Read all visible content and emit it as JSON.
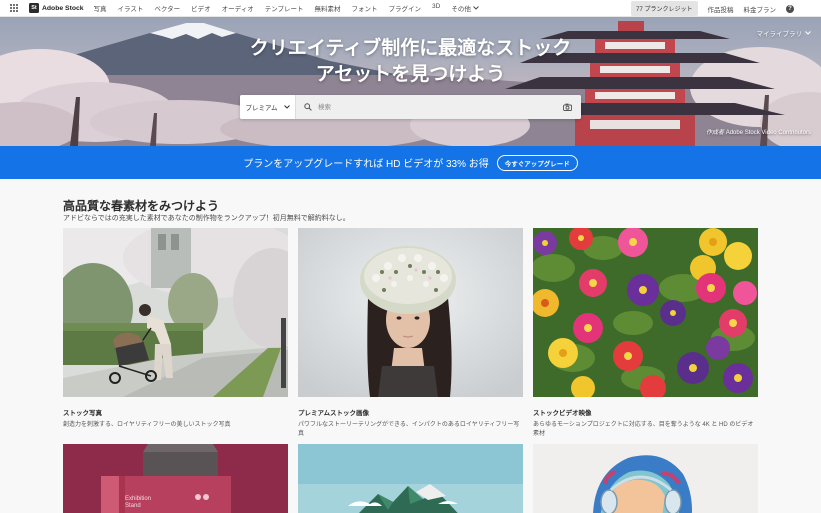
{
  "topnav": {
    "brand_logo": "St",
    "brand_name": "Adobe Stock",
    "links": [
      "写真",
      "イラスト",
      "ベクター",
      "ビデオ",
      "オーディオ",
      "テンプレート",
      "無料素材",
      "フォント",
      "プラグイン",
      "3D"
    ],
    "more_label": "その他",
    "credits_badge": "77 プランクレジット",
    "contributor_link": "作品投稿",
    "pricing_link": "料金プラン",
    "help_glyph": "?"
  },
  "hero": {
    "title_line1": "クリエイティブ制作に最適なストック",
    "title_line2": "アセットを見つけよう",
    "library_label": "マイライブラリ",
    "search": {
      "type_label": "プレミアム",
      "placeholder": "検索"
    },
    "credit_prefix": "作成者",
    "credit_name": "Adobe Stock Video Contributors"
  },
  "promo": {
    "text": "プランをアップグレードすれば HD ビデオが 33% お得",
    "button": "今すぐアップグレード"
  },
  "section": {
    "title": "高品質な春素材をみつけよう",
    "subtitle": "アドビならではの充実した素材であなたの制作物をランクアップ！初月無料で解約料なし。",
    "cards": [
      {
        "title": "ストック写真",
        "desc": "創造力を刺激する、ロイヤリティフリーの美しいストック写真"
      },
      {
        "title": "プレミアムストック画像",
        "desc": "パワフルなストーリーテリングができる、インパクトのあるロイヤリティフリー写真"
      },
      {
        "title": "ストックビデオ映像",
        "desc": "あらゆるモーションプロジェクトに対応する、目を奪うような 4K と HD のビデオ素材"
      }
    ],
    "template_box_text_1": "Exhibition",
    "template_box_text_2": "Stand"
  },
  "colors": {
    "promo_blue": "#1473e6",
    "content_bg": "#f8f8f8",
    "text_dark": "#2c2c2c"
  },
  "icons": [
    "apps-grid-icon",
    "chevron-down-icon",
    "help-icon",
    "search-icon",
    "camera-icon"
  ]
}
